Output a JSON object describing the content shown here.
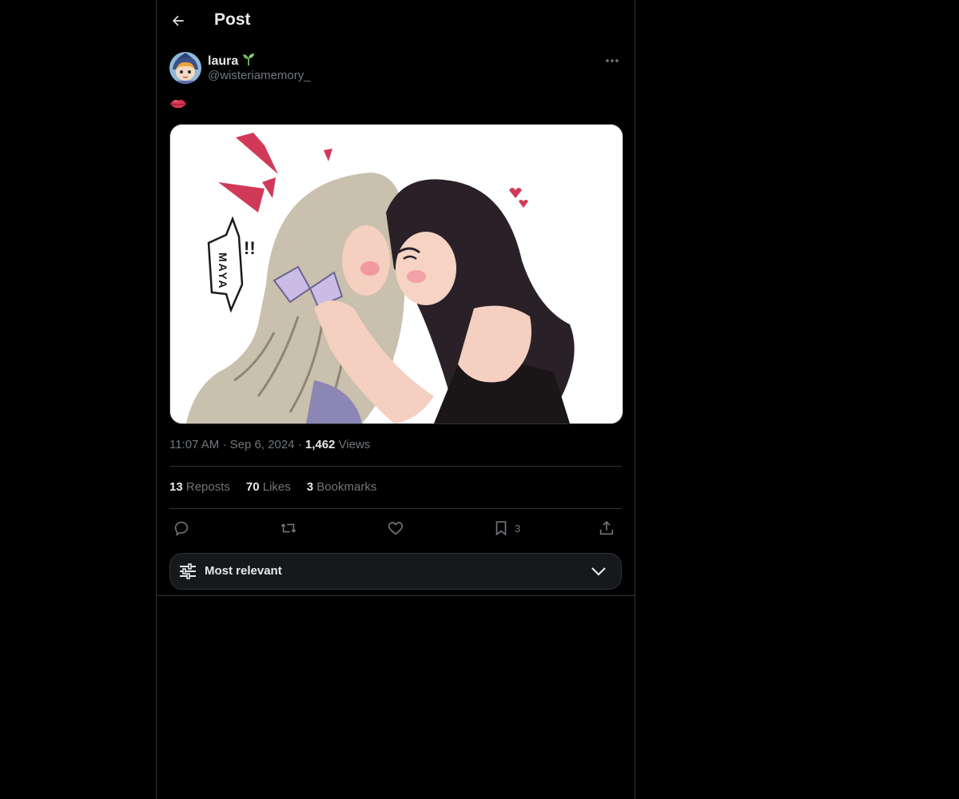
{
  "header": {
    "title": "Post"
  },
  "author": {
    "name": "laura",
    "name_emoji": "🌱",
    "handle": "@wisteriamemory_"
  },
  "post": {
    "text": "👄",
    "time": "11:07 AM",
    "separator": "·",
    "date": "Sep 6, 2024",
    "views_count": "1,462",
    "views_label": "Views",
    "media": {
      "speech_text": "MAYA",
      "exclaim": "!!"
    }
  },
  "stats": {
    "reposts_count": "13",
    "reposts_label": "Reposts",
    "likes_count": "70",
    "likes_label": "Likes",
    "bookmarks_count": "3",
    "bookmarks_label": "Bookmarks"
  },
  "actions": {
    "bookmark_count": "3"
  },
  "sort": {
    "label": "Most relevant"
  },
  "icons": {
    "back": "arrow-left-icon",
    "more": "more-horizontal-icon",
    "reply": "reply-icon",
    "repost": "repost-icon",
    "like": "heart-icon",
    "bookmark": "bookmark-icon",
    "share": "share-icon",
    "sort": "sliders-icon",
    "chevron": "chevron-down-icon"
  },
  "colors": {
    "background": "#000000",
    "text": "#e7e9ea",
    "muted": "#71767b",
    "border": "#2f3336",
    "sort_bar": "#16181c",
    "sprout": "#6bbf59"
  }
}
